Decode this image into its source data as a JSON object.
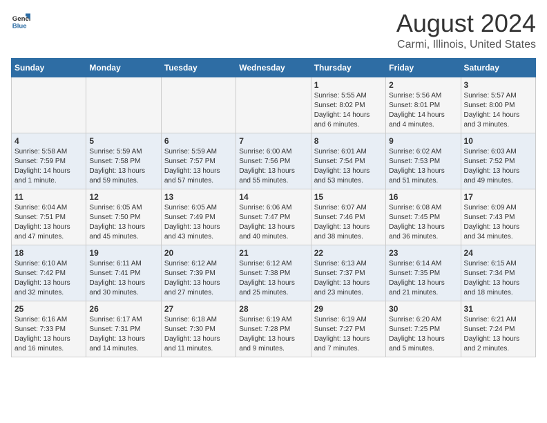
{
  "app": {
    "logo_line1": "General",
    "logo_line2": "Blue"
  },
  "title": "August 2024",
  "subtitle": "Carmi, Illinois, United States",
  "days_of_week": [
    "Sunday",
    "Monday",
    "Tuesday",
    "Wednesday",
    "Thursday",
    "Friday",
    "Saturday"
  ],
  "weeks": [
    [
      {
        "day": "",
        "info": ""
      },
      {
        "day": "",
        "info": ""
      },
      {
        "day": "",
        "info": ""
      },
      {
        "day": "",
        "info": ""
      },
      {
        "day": "1",
        "info": "Sunrise: 5:55 AM\nSunset: 8:02 PM\nDaylight: 14 hours\nand 6 minutes."
      },
      {
        "day": "2",
        "info": "Sunrise: 5:56 AM\nSunset: 8:01 PM\nDaylight: 14 hours\nand 4 minutes."
      },
      {
        "day": "3",
        "info": "Sunrise: 5:57 AM\nSunset: 8:00 PM\nDaylight: 14 hours\nand 3 minutes."
      }
    ],
    [
      {
        "day": "4",
        "info": "Sunrise: 5:58 AM\nSunset: 7:59 PM\nDaylight: 14 hours\nand 1 minute."
      },
      {
        "day": "5",
        "info": "Sunrise: 5:59 AM\nSunset: 7:58 PM\nDaylight: 13 hours\nand 59 minutes."
      },
      {
        "day": "6",
        "info": "Sunrise: 5:59 AM\nSunset: 7:57 PM\nDaylight: 13 hours\nand 57 minutes."
      },
      {
        "day": "7",
        "info": "Sunrise: 6:00 AM\nSunset: 7:56 PM\nDaylight: 13 hours\nand 55 minutes."
      },
      {
        "day": "8",
        "info": "Sunrise: 6:01 AM\nSunset: 7:54 PM\nDaylight: 13 hours\nand 53 minutes."
      },
      {
        "day": "9",
        "info": "Sunrise: 6:02 AM\nSunset: 7:53 PM\nDaylight: 13 hours\nand 51 minutes."
      },
      {
        "day": "10",
        "info": "Sunrise: 6:03 AM\nSunset: 7:52 PM\nDaylight: 13 hours\nand 49 minutes."
      }
    ],
    [
      {
        "day": "11",
        "info": "Sunrise: 6:04 AM\nSunset: 7:51 PM\nDaylight: 13 hours\nand 47 minutes."
      },
      {
        "day": "12",
        "info": "Sunrise: 6:05 AM\nSunset: 7:50 PM\nDaylight: 13 hours\nand 45 minutes."
      },
      {
        "day": "13",
        "info": "Sunrise: 6:05 AM\nSunset: 7:49 PM\nDaylight: 13 hours\nand 43 minutes."
      },
      {
        "day": "14",
        "info": "Sunrise: 6:06 AM\nSunset: 7:47 PM\nDaylight: 13 hours\nand 40 minutes."
      },
      {
        "day": "15",
        "info": "Sunrise: 6:07 AM\nSunset: 7:46 PM\nDaylight: 13 hours\nand 38 minutes."
      },
      {
        "day": "16",
        "info": "Sunrise: 6:08 AM\nSunset: 7:45 PM\nDaylight: 13 hours\nand 36 minutes."
      },
      {
        "day": "17",
        "info": "Sunrise: 6:09 AM\nSunset: 7:43 PM\nDaylight: 13 hours\nand 34 minutes."
      }
    ],
    [
      {
        "day": "18",
        "info": "Sunrise: 6:10 AM\nSunset: 7:42 PM\nDaylight: 13 hours\nand 32 minutes."
      },
      {
        "day": "19",
        "info": "Sunrise: 6:11 AM\nSunset: 7:41 PM\nDaylight: 13 hours\nand 30 minutes."
      },
      {
        "day": "20",
        "info": "Sunrise: 6:12 AM\nSunset: 7:39 PM\nDaylight: 13 hours\nand 27 minutes."
      },
      {
        "day": "21",
        "info": "Sunrise: 6:12 AM\nSunset: 7:38 PM\nDaylight: 13 hours\nand 25 minutes."
      },
      {
        "day": "22",
        "info": "Sunrise: 6:13 AM\nSunset: 7:37 PM\nDaylight: 13 hours\nand 23 minutes."
      },
      {
        "day": "23",
        "info": "Sunrise: 6:14 AM\nSunset: 7:35 PM\nDaylight: 13 hours\nand 21 minutes."
      },
      {
        "day": "24",
        "info": "Sunrise: 6:15 AM\nSunset: 7:34 PM\nDaylight: 13 hours\nand 18 minutes."
      }
    ],
    [
      {
        "day": "25",
        "info": "Sunrise: 6:16 AM\nSunset: 7:33 PM\nDaylight: 13 hours\nand 16 minutes."
      },
      {
        "day": "26",
        "info": "Sunrise: 6:17 AM\nSunset: 7:31 PM\nDaylight: 13 hours\nand 14 minutes."
      },
      {
        "day": "27",
        "info": "Sunrise: 6:18 AM\nSunset: 7:30 PM\nDaylight: 13 hours\nand 11 minutes."
      },
      {
        "day": "28",
        "info": "Sunrise: 6:19 AM\nSunset: 7:28 PM\nDaylight: 13 hours\nand 9 minutes."
      },
      {
        "day": "29",
        "info": "Sunrise: 6:19 AM\nSunset: 7:27 PM\nDaylight: 13 hours\nand 7 minutes."
      },
      {
        "day": "30",
        "info": "Sunrise: 6:20 AM\nSunset: 7:25 PM\nDaylight: 13 hours\nand 5 minutes."
      },
      {
        "day": "31",
        "info": "Sunrise: 6:21 AM\nSunset: 7:24 PM\nDaylight: 13 hours\nand 2 minutes."
      }
    ]
  ]
}
